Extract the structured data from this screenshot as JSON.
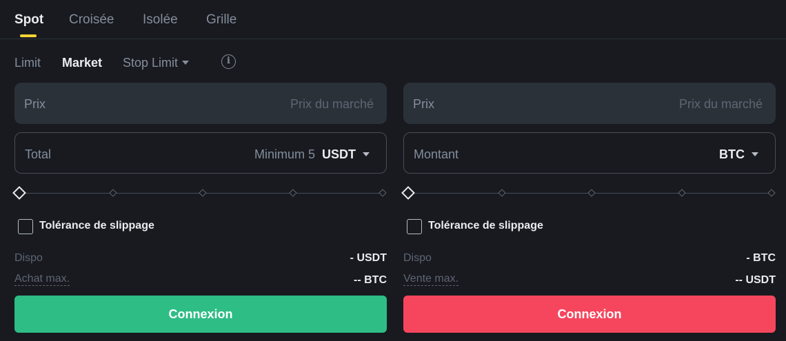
{
  "mode_tabs": [
    {
      "label": "Spot",
      "active": true
    },
    {
      "label": "Croisée",
      "active": false
    },
    {
      "label": "Isolée",
      "active": false
    },
    {
      "label": "Grille",
      "active": false
    }
  ],
  "order_tabs": {
    "limit": "Limit",
    "market": "Market",
    "stop_limit": "Stop Limit",
    "active": "market",
    "info_icon": "i"
  },
  "buy": {
    "price_label": "Prix",
    "price_placeholder": "Prix du marché",
    "amount_label": "Total",
    "amount_hint": "Minimum 5",
    "amount_unit": "USDT",
    "slider_percent": 0,
    "slippage_label": "Tolérance de slippage",
    "available_label": "Dispo",
    "available_value": "- USDT",
    "max_label": "Achat max.",
    "max_value": "-- BTC",
    "button_label": "Connexion",
    "button_color": "#2ebd85"
  },
  "sell": {
    "price_label": "Prix",
    "price_placeholder": "Prix du marché",
    "amount_label": "Montant",
    "amount_hint": "",
    "amount_unit": "BTC",
    "slider_percent": 0,
    "slippage_label": "Tolérance de slippage",
    "available_label": "Dispo",
    "available_value": "- BTC",
    "max_label": "Vente max.",
    "max_value": "-- USDT",
    "button_label": "Connexion",
    "button_color": "#f6465d"
  },
  "colors": {
    "background": "#181a20",
    "input_fill": "#2b3139",
    "accent": "#fcd535"
  }
}
